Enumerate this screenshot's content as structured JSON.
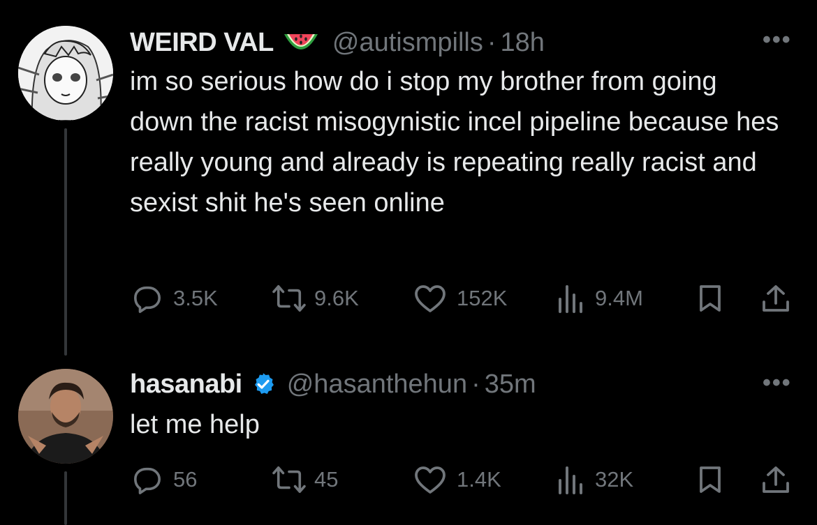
{
  "tweets": [
    {
      "name": "WEIRD VAL",
      "name_emoji": "watermelon-emoji",
      "handle": "@autismpills",
      "separator": "·",
      "time": "18h",
      "more": "•••",
      "text": "im so serious how do i stop my brother from going down the racist misogynistic incel pipeline because hes really young and already is repeating really racist and sexist shit he's seen online",
      "stats": {
        "replies": "3.5K",
        "reposts": "9.6K",
        "likes": "152K",
        "views": "9.4M"
      }
    },
    {
      "name": "hasanabi",
      "verified": true,
      "handle": "@hasanthehun",
      "separator": "·",
      "time": "35m",
      "more": "•••",
      "text": "let me help",
      "stats": {
        "replies": "56",
        "reposts": "45",
        "likes": "1.4K",
        "views": "32K"
      }
    }
  ],
  "colors": {
    "background": "#000000",
    "text": "#e7e9ea",
    "secondary": "#71767b",
    "verified": "#1d9bf0",
    "thread_line": "#333639"
  },
  "icons": [
    "reply-icon",
    "repost-icon",
    "like-icon",
    "views-icon",
    "bookmark-icon",
    "share-icon",
    "more-icon",
    "verified-badge-icon",
    "watermelon-emoji"
  ]
}
